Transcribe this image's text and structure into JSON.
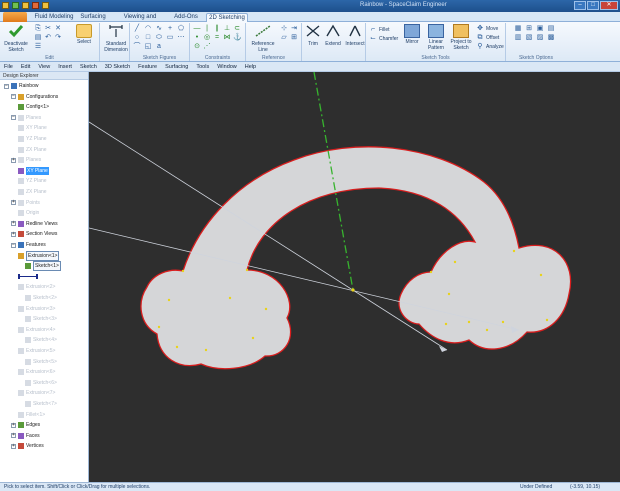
{
  "window": {
    "title": "Rainbow - SpaceClaim Engineer",
    "buttons": [
      "–",
      "□",
      "✕"
    ]
  },
  "ribbon_tabs": [
    "Fluid Modeling",
    "Surfacing",
    "Viewing and Analysis",
    "Add-Ons",
    "2D Sketching"
  ],
  "ribbon": {
    "deactivate": "Deactivate Sketch",
    "edit_label": "Edit",
    "select": "Select",
    "standard_dimension": "Standard Dimension",
    "sketch_figures_label": "Sketch Figures",
    "constraints_label": "Constraints",
    "reference_line": "Reference Line",
    "reference_label": "Reference",
    "trim": "Trim",
    "extend": "Extend",
    "intersect": "Intersect",
    "fillet": "Fillet",
    "chamfer": "Chamfer",
    "mirror": "Mirror",
    "linear_pattern": "Linear Pattern",
    "project_to_sketch": "Project to Sketch",
    "move": "Move",
    "offset": "Offset",
    "analyze": "Analyze",
    "sketch_tools_label": "Sketch Tools",
    "sketch_options_label": "Sketch Options"
  },
  "menu": [
    "File",
    "Edit",
    "View",
    "Insert",
    "Sketch",
    "3D Sketch",
    "Feature",
    "Surfacing",
    "Tools",
    "Window",
    "Help"
  ],
  "explorer": {
    "title": "Design Explorer",
    "nodes": [
      {
        "label": "Rainbow",
        "indent": 0,
        "state": "normal"
      },
      {
        "label": "Configurations",
        "indent": 1,
        "state": "normal"
      },
      {
        "label": "Config<1>",
        "indent": 2,
        "state": "normal"
      },
      {
        "label": "Planes",
        "indent": 1,
        "state": "dim"
      },
      {
        "label": "XY Plane",
        "indent": 2,
        "state": "dim"
      },
      {
        "label": "YZ Plane",
        "indent": 2,
        "state": "dim"
      },
      {
        "label": "ZX Plane",
        "indent": 2,
        "state": "dim"
      },
      {
        "label": "Planes",
        "indent": 1,
        "state": "dim"
      },
      {
        "label": "XY Plane",
        "indent": 2,
        "state": "sel"
      },
      {
        "label": "YZ Plane",
        "indent": 2,
        "state": "dim"
      },
      {
        "label": "ZX Plane",
        "indent": 2,
        "state": "dim"
      },
      {
        "label": "Points",
        "indent": 1,
        "state": "dim"
      },
      {
        "label": "Origin",
        "indent": 2,
        "state": "dim"
      },
      {
        "label": "Redline Views",
        "indent": 1,
        "state": "normal"
      },
      {
        "label": "Section Views",
        "indent": 1,
        "state": "normal"
      },
      {
        "label": "Features",
        "indent": 1,
        "state": "normal"
      },
      {
        "label": "Extrusion<1>",
        "indent": 2,
        "state": "boxed"
      },
      {
        "label": "Sketch<1>",
        "indent": 3,
        "state": "boxed"
      },
      {
        "label": "",
        "indent": 2,
        "state": "marker"
      },
      {
        "label": "Extrusion<2>",
        "indent": 2,
        "state": "dim"
      },
      {
        "label": "Sketch<2>",
        "indent": 3,
        "state": "dim"
      },
      {
        "label": "Extrusion<3>",
        "indent": 2,
        "state": "dim"
      },
      {
        "label": "Sketch<3>",
        "indent": 3,
        "state": "dim"
      },
      {
        "label": "Extrusion<4>",
        "indent": 2,
        "state": "dim"
      },
      {
        "label": "Sketch<4>",
        "indent": 3,
        "state": "dim"
      },
      {
        "label": "Extrusion<5>",
        "indent": 2,
        "state": "dim"
      },
      {
        "label": "Sketch<5>",
        "indent": 3,
        "state": "dim"
      },
      {
        "label": "Extrusion<6>",
        "indent": 2,
        "state": "dim"
      },
      {
        "label": "Sketch<6>",
        "indent": 3,
        "state": "dim"
      },
      {
        "label": "Extrusion<7>",
        "indent": 2,
        "state": "dim"
      },
      {
        "label": "Sketch<7>",
        "indent": 3,
        "state": "dim"
      },
      {
        "label": "Fillet<1>",
        "indent": 2,
        "state": "dim"
      },
      {
        "label": "Edges",
        "indent": 1,
        "state": "normal"
      },
      {
        "label": "Faces",
        "indent": 1,
        "state": "normal"
      },
      {
        "label": "Vertices",
        "indent": 1,
        "state": "normal"
      }
    ]
  },
  "statusbar": {
    "message": "Pick to select item. Shift/Click or Click/Drag for multiple selections.",
    "state": "Under Defined",
    "coords": "(-3.59, 10.15)"
  },
  "colors": {
    "sketch_fill": "#d5d6d8",
    "sketch_outline": "#d81e1e",
    "viewport_bg": "#2e2e2e",
    "axis_green": "#37b42e",
    "vertex_yellow": "#e8d21a"
  }
}
